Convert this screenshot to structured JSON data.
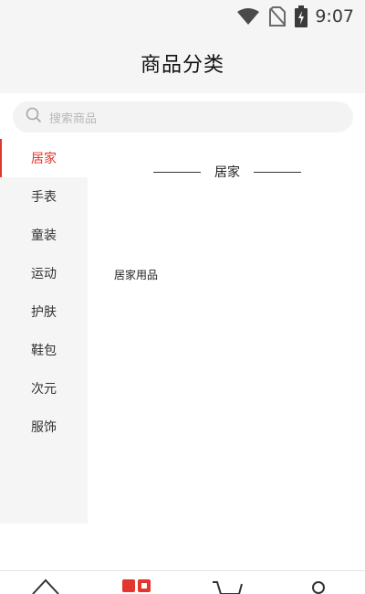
{
  "status_bar": {
    "time": "9:07",
    "icons": [
      "wifi-icon",
      "no-sim-icon",
      "battery-charging-icon"
    ]
  },
  "header": {
    "title": "商品分类"
  },
  "search": {
    "placeholder": "搜索商品",
    "icon": "search-icon"
  },
  "sidebar": {
    "active_index": 0,
    "items": [
      {
        "label": "居家"
      },
      {
        "label": "手表"
      },
      {
        "label": "童装"
      },
      {
        "label": "运动"
      },
      {
        "label": "护肤"
      },
      {
        "label": "鞋包"
      },
      {
        "label": "次元"
      },
      {
        "label": "服饰"
      }
    ]
  },
  "content": {
    "heading": "居家",
    "items": [
      {
        "label": "居家用品"
      }
    ]
  },
  "bottom_nav": {
    "items": [
      {
        "icon": "home-icon"
      },
      {
        "icon": "category-icon",
        "active": true
      },
      {
        "icon": "cart-icon"
      },
      {
        "icon": "profile-icon"
      }
    ]
  },
  "colors": {
    "accent": "#e2362e",
    "background_gray": "#f5f5f5"
  }
}
